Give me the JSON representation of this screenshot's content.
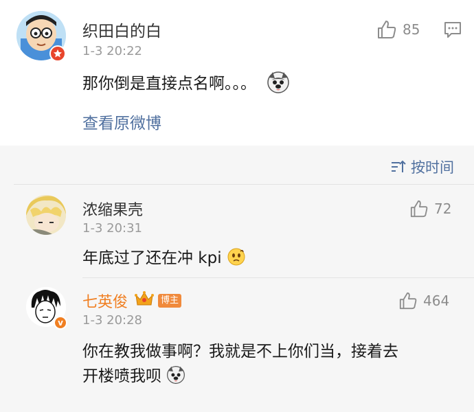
{
  "main_post": {
    "user_name": "织田白的白",
    "time": "1-3 20:22",
    "like_count": "85",
    "content": "那你倒是直接点名啊。。。",
    "view_original": "查看原微博",
    "icons": [
      "thumb-up-icon",
      "comment-icon",
      "dog-emoji-icon"
    ]
  },
  "sort": {
    "label": "按时间",
    "icon": "sort-icon"
  },
  "comments": [
    {
      "user_name": "浓缩果壳",
      "time": "1-3 20:31",
      "like_count": "72",
      "content": "年底过了还在冲 kpi"
    },
    {
      "user_name": "七英俊",
      "name_color": "#f07f22",
      "tag": "博主",
      "time": "1-3 20:28",
      "like_count": "464",
      "content_line1": "你在教我做事啊？我就是不上你们当，接着去",
      "content_line2": "开楼喷我呗"
    }
  ],
  "colors": {
    "link": "#50709f",
    "blogger_name": "#f07f22",
    "blogger_tag": "#f08a3c",
    "vip_badge": "#e8452c"
  }
}
